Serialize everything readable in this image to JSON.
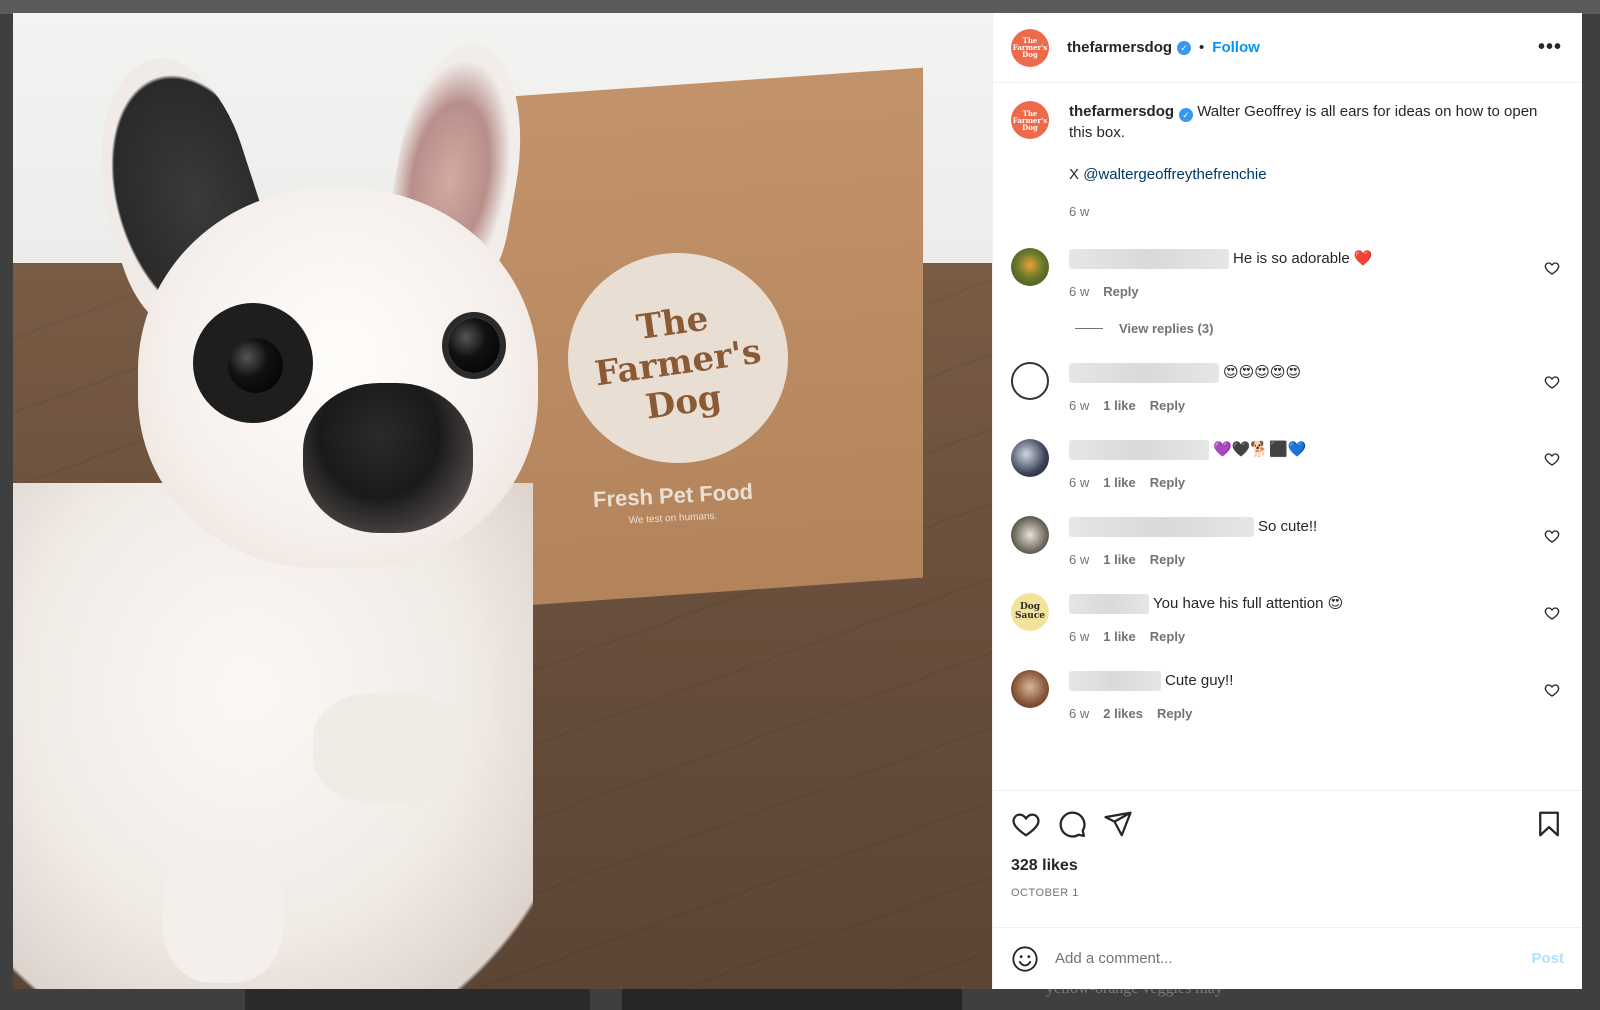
{
  "post": {
    "username": "thefarmersdog",
    "verified_glyph": "✓",
    "follow_label": "Follow",
    "more_label": "•••",
    "avatar_text": "The Farmer's Dog",
    "separator": "•",
    "image": {
      "box_logo": "The Farmer's Dog",
      "box_sub": "Fresh Pet Food",
      "box_sub2": "We test on humans."
    },
    "caption": {
      "username": "thefarmersdog",
      "text": "Walter Geoffrey is all ears for ideas on how to open this box.",
      "credit_prefix": "X",
      "mention": "@waltergeoffreythefrenchie",
      "time": "6 w"
    },
    "likes": "328 likes",
    "date": "OCTOBER 1"
  },
  "comments": [
    {
      "text": "He is so adorable ❤️",
      "time": "6 w",
      "likes": "",
      "reply": "Reply",
      "avatar_color": "#6b7a2c"
    },
    {
      "text": "😍😍😍😍😍",
      "time": "6 w",
      "likes": "1 like",
      "reply": "Reply",
      "avatar_color": "#ffffff"
    },
    {
      "text": "💜🖤🐕‍⬛💙",
      "time": "6 w",
      "likes": "1 like",
      "reply": "Reply",
      "avatar_color": "#3a4258"
    },
    {
      "text": "So cute!!",
      "time": "6 w",
      "likes": "1 like",
      "reply": "Reply",
      "avatar_color": "#6e6a5e"
    },
    {
      "text": "You have his full attention 😍",
      "time": "6 w",
      "likes": "1 like",
      "reply": "Reply",
      "avatar_color": "#f3e39a",
      "avatar_text": "Dog Sauce"
    },
    {
      "text": "Cute guy!!",
      "time": "6 w",
      "likes": "2 likes",
      "reply": "Reply",
      "avatar_color": "#8a5a3c"
    }
  ],
  "view_replies": "View replies (3)",
  "add_comment": {
    "placeholder": "Add a comment...",
    "post_label": "Post"
  },
  "background_text": "yellow-orange veggies may",
  "colors": {
    "accent": "#0095f6",
    "brand": "#ef6a4a",
    "mention": "#00376b"
  },
  "icons": [
    "like-icon",
    "comment-icon",
    "share-icon",
    "save-icon",
    "emoji-icon",
    "heart-icon",
    "more-icon",
    "verified-icon"
  ]
}
